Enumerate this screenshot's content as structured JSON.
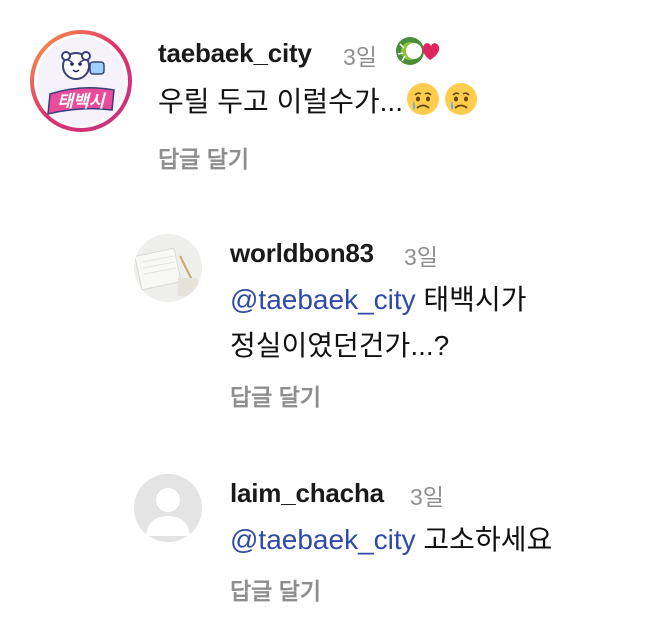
{
  "comments": [
    {
      "username": "taebaek_city",
      "time": "3일",
      "text": "우릴 두고 이럴수가...",
      "emojis": [
        "crying-face-icon",
        "crying-face-icon"
      ],
      "reply_label": "답글 달기",
      "avatar_text": "태백시"
    },
    {
      "username": "worldbon83",
      "time": "3일",
      "mention": "@taebaek_city",
      "text_line1": " 태백시가",
      "text_line2": "정실이였던건가...?",
      "reply_label": "답글 달기"
    },
    {
      "username": "laim_chacha",
      "time": "3일",
      "mention": "@taebaek_city",
      "text": " 고소하세요",
      "reply_label": "답글 달기"
    }
  ],
  "colors": {
    "mention": "#2f4aa8",
    "muted": "#8e8e8e",
    "ring_start": "#f9a03f",
    "ring_end": "#c13584"
  }
}
